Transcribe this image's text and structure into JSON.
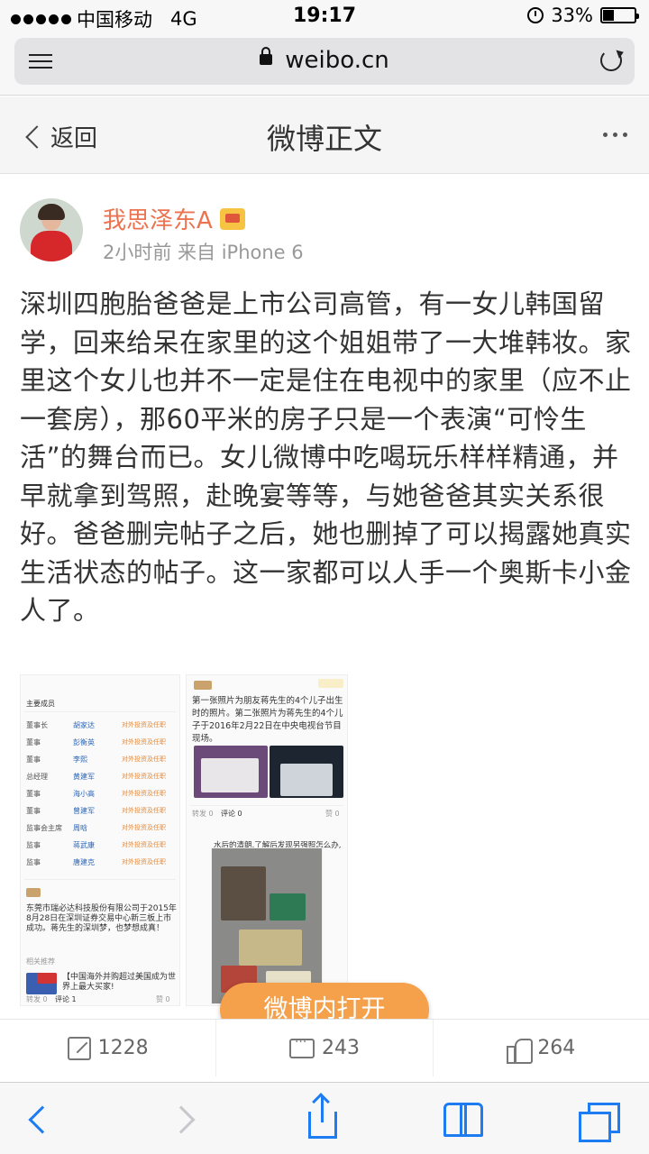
{
  "status_bar": {
    "carrier": "中国移动",
    "network": "4G",
    "time": "19:17",
    "battery": "33%"
  },
  "browser": {
    "url": "weibo.cn"
  },
  "nav": {
    "back_label": "返回",
    "title": "微博正文"
  },
  "post": {
    "username": "我思泽东A",
    "meta": "2小时前  来自 iPhone 6",
    "text": "深圳四胞胎爸爸是上市公司高管，有一女儿韩国留学，回来给呆在家里的这个姐姐带了一大堆韩妆。家里这个女儿也并不一定是住在电视中的家里（应不止一套房），那60平米的房子只是一个表演“可怜生活”的舞台而已。女儿微博中吃喝玩乐样样精通，并早就拿到驾照，赴晚宴等等，与她爸爸其实关系很好。爸爸删完帖子之后，她也删掉了可以揭露她真实生活状态的帖子。这一家都可以人手一个奥斯卡小金人了。"
  },
  "pic1": {
    "header": "主要成员",
    "rows": [
      {
        "role": "董事长",
        "name": "胡家达"
      },
      {
        "role": "董事",
        "name": "彭衡英"
      },
      {
        "role": "董事",
        "name": "李熙"
      },
      {
        "role": "总经理",
        "name": "黄建军"
      },
      {
        "role": "董事",
        "name": "海小高"
      },
      {
        "role": "董事",
        "name": "曾建军"
      },
      {
        "role": "监事会主席",
        "name": "周晗"
      },
      {
        "role": "监事",
        "name": "蒋武康"
      },
      {
        "role": "监事",
        "name": "唐建克"
      }
    ],
    "row_link": "对外投资及任职",
    "news": "东莞市瑞必达科技股份有限公司于2015年8月28日在深圳证券交易中心新三板上市成功。蒋先生的深圳梦，也梦想成真！",
    "related": "相关推荐",
    "related_item": "【中国海外并购超过美国成为世界上最大买家!",
    "footer_repost": "转发 0",
    "footer_comment": "评论 1",
    "footer_like": "赞 0"
  },
  "pic2": {
    "caption": "第一张照片为朋友蒋先生的4个儿子出生时的照片。第二张照片为蒋先生的4个儿子于2016年2月22日在中央电视台节目现场。",
    "footer_repost": "转发 0",
    "footer_comment": "评论 0",
    "footer_like": "赞 0",
    "bottom_text": "水后的清朗,了解后发现另强照怎么办,我只相信我自己啊."
  },
  "open_button": "微博内打开",
  "actions": {
    "repost": "1228",
    "comment": "243",
    "like": "264"
  }
}
